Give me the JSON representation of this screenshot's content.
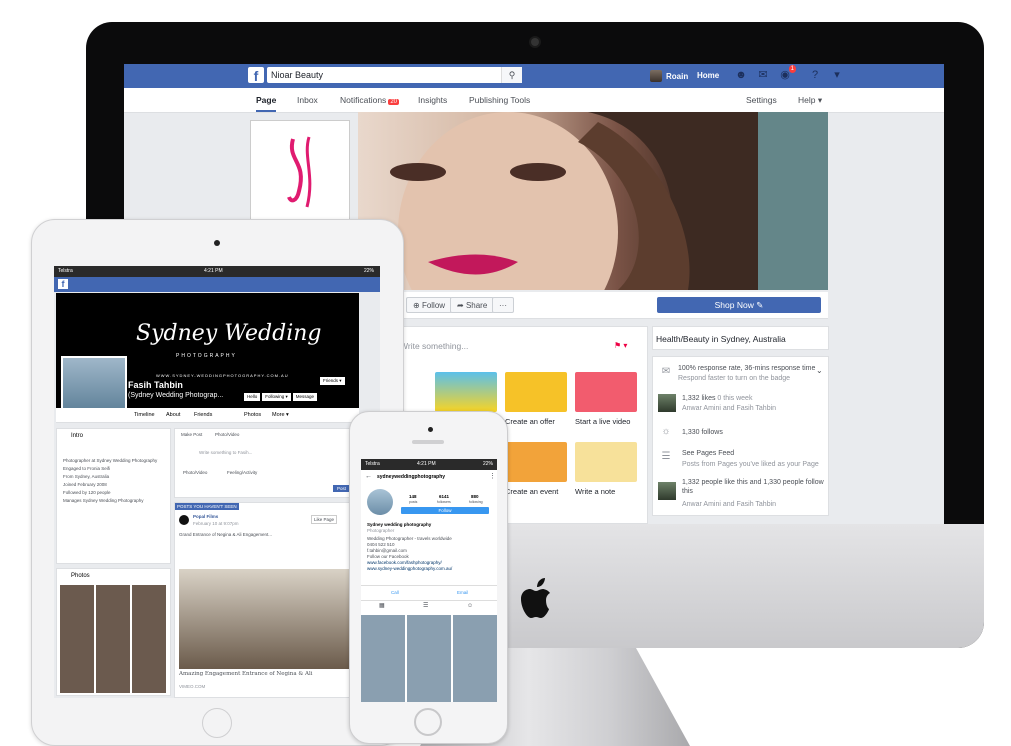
{
  "desktop": {
    "search_value": "Nioar Beauty",
    "user_name": "Roain",
    "home_label": "Home",
    "notification_count": "1",
    "tabs": [
      "Page",
      "Inbox",
      "Notifications",
      "Insights",
      "Publishing Tools",
      "Settings",
      "Help"
    ],
    "notifications_badge": "20",
    "follow_label": "Follow",
    "share_label": "Share",
    "more_label": "···",
    "shop_now_label": "Shop Now",
    "composer_placeholder": "Write something...",
    "tiles": [
      "Create an offer",
      "Start a live video",
      "Create an event",
      "Write a note"
    ],
    "about": {
      "category": "Health/Beauty in Sydney, Australia",
      "response": "100% response rate, 36-mins response time",
      "response_sub": "Respond faster to turn on the badge",
      "likes": "1,332 likes",
      "likes_week": "0 this week",
      "likes_people": "Anwar Amini and Fasih Tahbin",
      "follows": "1,330 follows",
      "feed_title": "See Pages Feed",
      "feed_sub": "Posts from Pages you've liked as your Page",
      "people_like": "1,332 people like this and 1,330 people follow this",
      "people_names": "Anwar Amini and Fasih Tahbin"
    },
    "colors": {
      "fb_blue": "#4267b2",
      "badge_red": "#fa3e3e"
    }
  },
  "tablet": {
    "carrier": "Telstra",
    "time": "4:21 PM",
    "battery": "22%",
    "cover_title": "Sydney Wedding",
    "cover_sub": "PHOTOGRAPHY",
    "cover_url": "WWW.SYDNEY-WEDDINGPHOTOGRAPHY.COM.AU",
    "name": "Fasih Tahbin",
    "handle": "(Sydney Wedding Photograp...",
    "friends_btn": "Friends ▾",
    "hello_btn": "Hello",
    "following_btn": "Following ▾",
    "message_btn": "Message",
    "tabs": [
      "Timeline",
      "About",
      "Friends",
      "Photos",
      "More ▾"
    ],
    "intro_title": "Intro",
    "intro_lines": [
      "Photographer at Sydney Wedding Photography",
      "Engaged to Fronia Seifi",
      "From Sydney, Australia",
      "Joined February 2008",
      "Followed by 120 people",
      "Manages Sydney Wedding Photography"
    ],
    "photos_title": "Photos",
    "make_post": "Make Post",
    "photo_video": "Photo/Video",
    "write_placeholder": "Write something to Fasih...",
    "feeling": "Feeling/Activity",
    "post_btn": "Post",
    "posts_header": "POSTS YOU HAVEN'T SEEN",
    "post_author": "Popal Films",
    "post_time": "February 10 at 9:07pm",
    "post_text": "Grand Entrance of Negina & Ali Engagement...",
    "like_page": "Like Page",
    "post_caption": "Amazing Engagement Entrance of Negina & Ali",
    "post_domain": "VIMEO.COM"
  },
  "phone": {
    "carrier": "Telstra",
    "time": "4:21 PM",
    "battery": "22%",
    "username": "sydneyweddingphotography",
    "posts": "148",
    "posts_label": "posts",
    "followers": "6141",
    "followers_label": "followers",
    "following": "880",
    "following_label": "following",
    "follow_btn": "Follow",
    "bio_name": "Sydney wedding photography",
    "bio_cat": "Photographer",
    "bio_lines": [
      "Wedding Photographer - travels worldwide",
      "0404 522 510",
      "f.tahbin@gmail.com",
      "Follow our Facebook",
      "www.facebook.com/fashphotography/",
      "www.sydney-weddingphotography.com.au/"
    ],
    "call": "Call",
    "email": "Email"
  }
}
